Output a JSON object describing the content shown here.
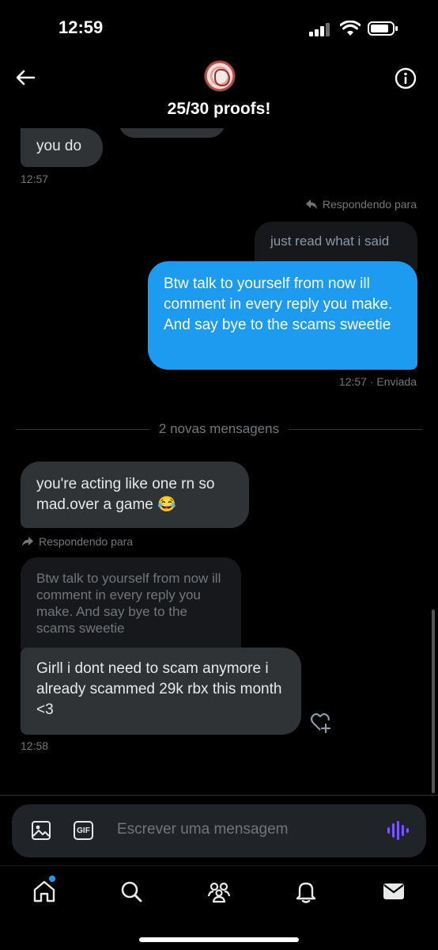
{
  "status_bar": {
    "time": "12:59"
  },
  "header": {
    "title": "25/30 proofs!"
  },
  "messages": {
    "m1": {
      "text": "you do",
      "time": "12:57"
    },
    "reply_to_label_out": "Respondendo para",
    "quote_out": "just read what i said",
    "m2": {
      "text": "Btw talk to yourself from now ill comment in every reply you make. And say bye to the scams sweetie",
      "meta": "12:57 · Enviada"
    },
    "divider": "2 novas mensagens",
    "m3": {
      "text": "you're acting like one rn so mad.over a game 😂"
    },
    "reply_to_label_in": "Respondendo para",
    "quote_in": "Btw talk to yourself from now ill comment in every reply you make. And say bye to the scams sweetie",
    "m4": {
      "text": "Girll i dont need to scam anymore i already scammed 29k rbx this month <3",
      "time": "12:58"
    }
  },
  "composer": {
    "placeholder": "Escrever uma mensagem",
    "gif_label": "GIF"
  },
  "nav": [
    "home-icon",
    "search-icon",
    "communities-icon",
    "notifications-icon",
    "messages-icon"
  ],
  "colors": {
    "accent": "#1d9bf0",
    "bubble_in": "#2f3336",
    "voice": "#7856ff"
  }
}
